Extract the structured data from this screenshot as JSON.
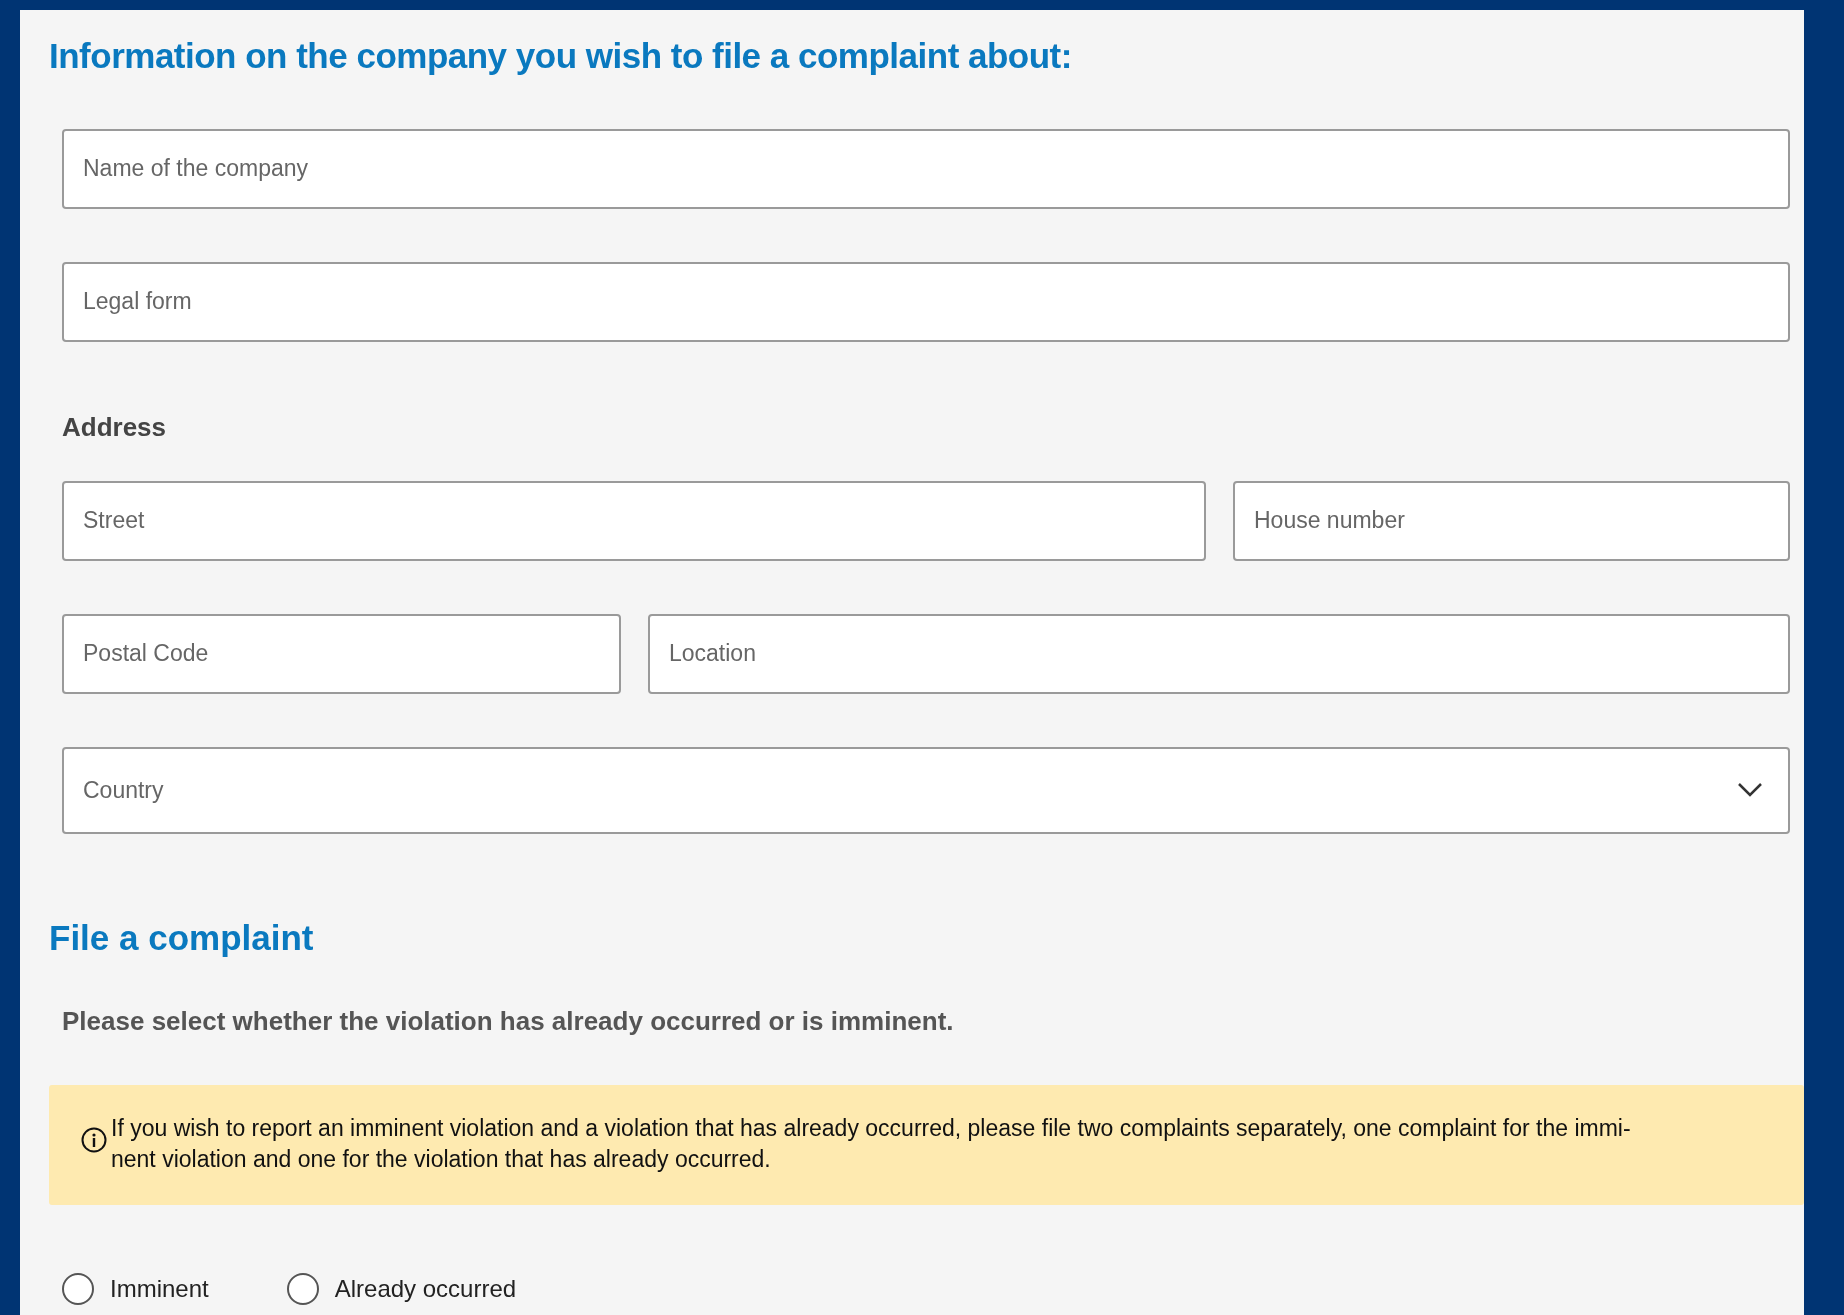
{
  "heading": "Information on the company you wish to file a complaint about:",
  "fields": [
    {
      "placeholder": "Name of the company"
    },
    {
      "placeholder": "Legal form"
    }
  ],
  "address": {
    "label": "Address",
    "rows": [
      [
        {
          "placeholder": "Street"
        },
        {
          "placeholder": "House number"
        }
      ],
      [
        {
          "placeholder": "Postal Code"
        },
        {
          "placeholder": "Location"
        }
      ]
    ],
    "country": {
      "placeholder": "Country"
    }
  },
  "complaint": {
    "heading": "File a complaint",
    "question": "Please select whether the violation has already occurred or is imminent.",
    "info": "If you wish to report an imminent violation and a violation that has already occurred, please file two complaints separately, one complaint for the immi-nent violation and one for the violation that has already occurred.",
    "options": [
      {
        "label": "Imminent",
        "selected": false
      },
      {
        "label": "Already occurred",
        "selected": false
      }
    ]
  }
}
